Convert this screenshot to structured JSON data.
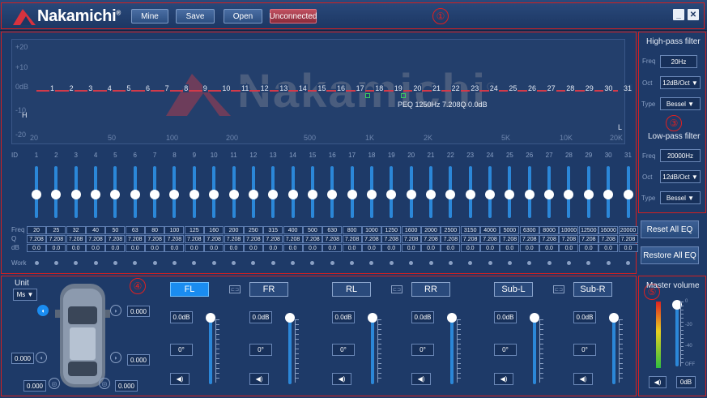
{
  "brand": {
    "name": "Nakamichi",
    "mark": "®"
  },
  "toolbar": {
    "mine": "Mine",
    "save": "Save",
    "open": "Open",
    "status": "Unconnected"
  },
  "window": {
    "minimize": "_",
    "close": "✕"
  },
  "regions": [
    "①",
    "②",
    "③",
    "④",
    "⑤"
  ],
  "graph": {
    "db_labels": [
      "+20",
      "+10",
      "0dB",
      "-10",
      "-20"
    ],
    "freq_labels": [
      "20",
      "50",
      "100",
      "200",
      "500",
      "1K",
      "2K",
      "5K",
      "10K",
      "20K"
    ],
    "corner_h": "H",
    "corner_l": "L",
    "readout": "PEQ 1250Hz 7.208Q 0.0dB",
    "watermark": "Nakamichi",
    "watermark_mark": "®",
    "eq_band_levels_db": [
      0,
      0,
      0,
      0,
      0,
      0,
      0,
      0,
      0,
      0,
      0,
      0,
      0,
      0,
      0,
      0,
      0,
      0,
      0,
      0,
      0,
      0,
      0,
      0,
      0,
      0,
      0,
      0,
      0,
      0,
      0
    ]
  },
  "bands": {
    "id_label": "ID",
    "ids": [
      "1",
      "2",
      "3",
      "4",
      "5",
      "6",
      "7",
      "8",
      "9",
      "10",
      "11",
      "12",
      "13",
      "14",
      "15",
      "16",
      "17",
      "18",
      "19",
      "20",
      "21",
      "22",
      "23",
      "24",
      "25",
      "26",
      "27",
      "28",
      "29",
      "30",
      "31"
    ],
    "freq_label": "Freq",
    "q_label": "Q",
    "db_label": "dB",
    "work_label": "Work",
    "freqs": [
      "20",
      "25",
      "32",
      "40",
      "50",
      "63",
      "80",
      "100",
      "125",
      "160",
      "200",
      "250",
      "315",
      "400",
      "500",
      "630",
      "800",
      "1000",
      "1250",
      "1600",
      "2000",
      "2500",
      "3150",
      "4000",
      "5000",
      "6300",
      "8000",
      "10000",
      "12500",
      "16000",
      "20000"
    ],
    "q": "7.208",
    "db": "0.0"
  },
  "highpass": {
    "title": "High-pass filter",
    "freq_label": "Freq",
    "freq": "20Hz",
    "oct_label": "Oct",
    "oct": "12dB/Oct ▼",
    "type_label": "Type",
    "type": "Bessel ▼"
  },
  "lowpass": {
    "title": "Low-pass filter",
    "freq_label": "Freq",
    "freq": "20000Hz",
    "oct_label": "Oct",
    "oct": "12dB/Oct ▼",
    "type_label": "Type",
    "type": "Bessel ▼"
  },
  "actions": {
    "reset": "Reset All EQ",
    "restore": "Restore All EQ"
  },
  "delay": {
    "unit_label": "Unit",
    "unit": "Ms ▼",
    "values": [
      "0.000",
      "0.000",
      "0.000",
      "0.000",
      "0.000",
      "0.000"
    ]
  },
  "channels": [
    {
      "name": "FL",
      "gain": "0.0dB",
      "phase": "0°",
      "active": true
    },
    {
      "name": "FR",
      "gain": "0.0dB",
      "phase": "0°",
      "active": false
    },
    {
      "name": "RL",
      "gain": "0.0dB",
      "phase": "0°",
      "active": false
    },
    {
      "name": "RR",
      "gain": "0.0dB",
      "phase": "0°",
      "active": false
    },
    {
      "name": "Sub-L",
      "gain": "0.0dB",
      "phase": "0°",
      "active": false
    },
    {
      "name": "Sub-R",
      "gain": "0.0dB",
      "phase": "0°",
      "active": false
    }
  ],
  "master": {
    "title": "Master volume",
    "scale": [
      "0",
      "-20",
      "-40",
      "OFF"
    ],
    "value": "0dB",
    "level_fraction": 1.0
  },
  "colors": {
    "background": "#1e3a68",
    "accent": "#1a8cf0",
    "eq_line": "#d23a4a",
    "annotation": "#d42020"
  }
}
